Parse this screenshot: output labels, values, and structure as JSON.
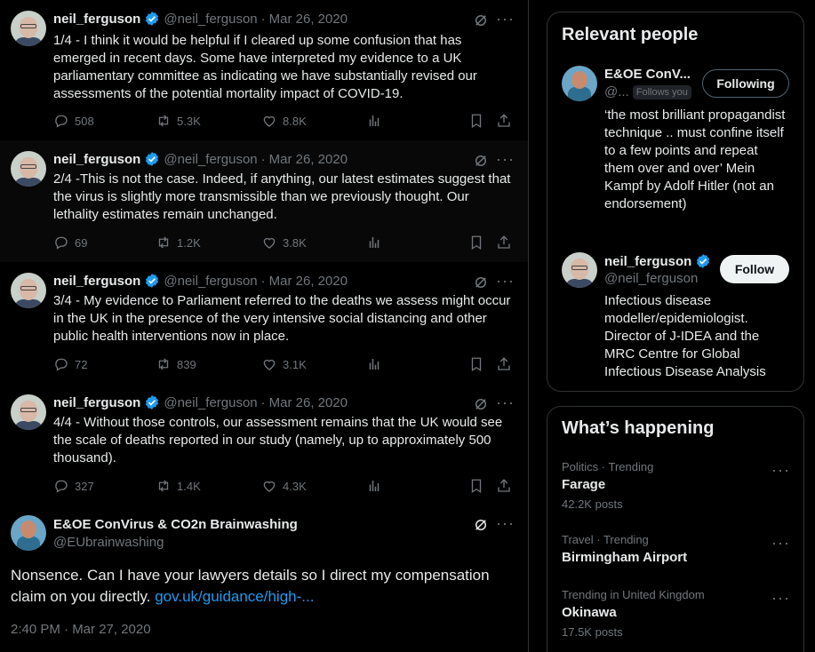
{
  "tweets": [
    {
      "name": "neil_ferguson",
      "handle": "@neil_ferguson",
      "sep": "·",
      "date": "Mar 26, 2020",
      "text": "1/4 - I think it would be helpful if I cleared up some confusion that has emerged in recent days. Some have interpreted my evidence to a UK parliamentary committee as indicating we have substantially revised our assessments of the potential mortality impact of COVID-19.",
      "replies": "508",
      "reposts": "5.3K",
      "likes": "8.8K"
    },
    {
      "name": "neil_ferguson",
      "handle": "@neil_ferguson",
      "sep": "·",
      "date": "Mar 26, 2020",
      "text": "2/4 -This is not the case. Indeed, if anything, our latest estimates suggest that the virus is slightly more transmissible than we previously thought. Our lethality estimates remain unchanged.",
      "replies": "69",
      "reposts": "1.2K",
      "likes": "3.8K"
    },
    {
      "name": "neil_ferguson",
      "handle": "@neil_ferguson",
      "sep": "·",
      "date": "Mar 26, 2020",
      "text": "3/4 - My evidence to Parliament referred to the deaths we assess might occur in the UK in the presence of the very intensive social distancing and other public health interventions now in place.",
      "replies": "72",
      "reposts": "839",
      "likes": "3.1K"
    },
    {
      "name": "neil_ferguson",
      "handle": "@neil_ferguson",
      "sep": "·",
      "date": "Mar 26, 2020",
      "text": "4/4 - Without those controls, our assessment remains that the UK would see the scale of deaths reported in our study (namely, up to approximately 500 thousand).",
      "replies": "327",
      "reposts": "1.4K",
      "likes": "4.3K"
    }
  ],
  "focal": {
    "name": "E&OE ConVirus & CO2n Brainwashing",
    "handle": "@EUbrainwashing",
    "text": "Nonsence. Can I have your lawyers details so I direct my compensation claim on you directly. ",
    "link": "gov.uk/guidance/high-...",
    "time": "2:40 PM · Mar 27, 2020"
  },
  "relevant_people": {
    "title": "Relevant people",
    "people": [
      {
        "name": "E&OE ConV...",
        "handle": "@...",
        "badge": "Follows you",
        "button": "Following",
        "bio": "‘the most brilliant propagandist technique .. must confine itself to a few points and repeat them over and over’ Mein Kampf by Adolf Hitler (not an endorsement)"
      },
      {
        "name": "neil_ferguson",
        "handle": "@neil_ferguson",
        "button": "Follow",
        "bio": "Infectious disease modeller/epidemiologist. Director of J-IDEA and the MRC Centre for Global Infectious Disease Analysis"
      }
    ]
  },
  "whats_happening": {
    "title": "What’s happening",
    "trends": [
      {
        "category": "Politics · Trending",
        "name": "Farage",
        "count": "42.2K posts"
      },
      {
        "category": "Travel · Trending",
        "name": "Birmingham Airport",
        "count": ""
      },
      {
        "category": "Trending in United Kingdom",
        "name": "Okinawa",
        "count": "17.5K posts"
      }
    ]
  },
  "colors": {
    "background": "#000000",
    "text": "#e7e9ea",
    "muted": "#71767b",
    "accent": "#1d9bf0",
    "border": "#2f3336"
  },
  "icons": [
    "verified-icon",
    "grok-icon",
    "more-icon",
    "reply-icon",
    "repost-icon",
    "like-icon",
    "views-icon",
    "bookmark-icon",
    "share-icon"
  ]
}
